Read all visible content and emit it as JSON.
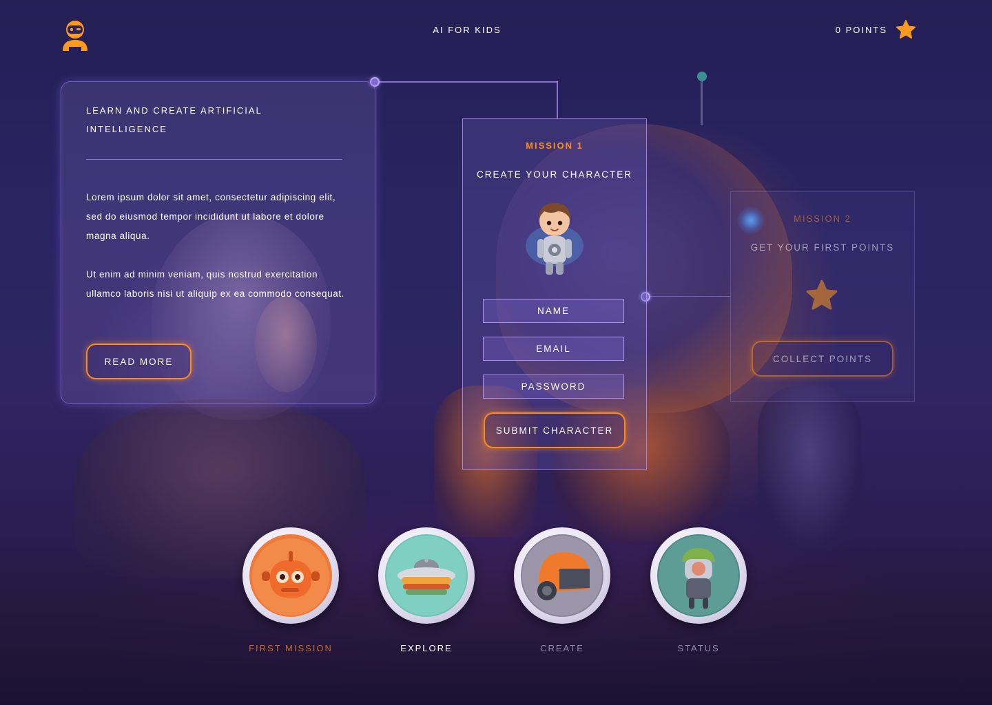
{
  "header": {
    "title": "AI FOR KIDS",
    "points_label": "0 POINTS",
    "logo_icon": "astronaut-logo-icon",
    "points_icon": "star-icon"
  },
  "intro": {
    "heading": "LEARN AND CREATE ARTIFICIAL INTELLIGENCE",
    "paragraph_1": "Lorem ipsum dolor sit amet, consectetur adipiscing elit, sed do eiusmod tempor incididunt ut labore et dolore magna aliqua.",
    "paragraph_2": "Ut enim ad minim veniam, quis nostrud exercitation ullamco laboris nisi ut aliquip ex ea commodo consequat.",
    "button_label": "READ MORE"
  },
  "mission_1": {
    "label": "MISSION 1",
    "title": "CREATE YOUR CHARACTER",
    "image_icon": "character-avatar-icon",
    "fields": {
      "name": "NAME",
      "email": "EMAIL",
      "password": "PASSWORD"
    },
    "submit_label": "SUBMIT CHARACTER"
  },
  "mission_2": {
    "label": "MISSION 2",
    "title": "GET YOUR FIRST POINTS",
    "image_icon": "star-icon",
    "button_label": "COLLECT POINTS"
  },
  "nav": [
    {
      "label": "FIRST MISSION",
      "icon": "robot-face-icon",
      "state": "active"
    },
    {
      "label": "EXPLORE",
      "icon": "spaceship-icon",
      "state": "highlighted"
    },
    {
      "label": "CREATE",
      "icon": "helmet-icon",
      "state": "inactive"
    },
    {
      "label": "STATUS",
      "icon": "astronaut-status-icon",
      "state": "inactive"
    }
  ],
  "colors": {
    "accent": "#ff8c1a",
    "panel_border": "#b4a0ff",
    "background": "#2a2462"
  }
}
